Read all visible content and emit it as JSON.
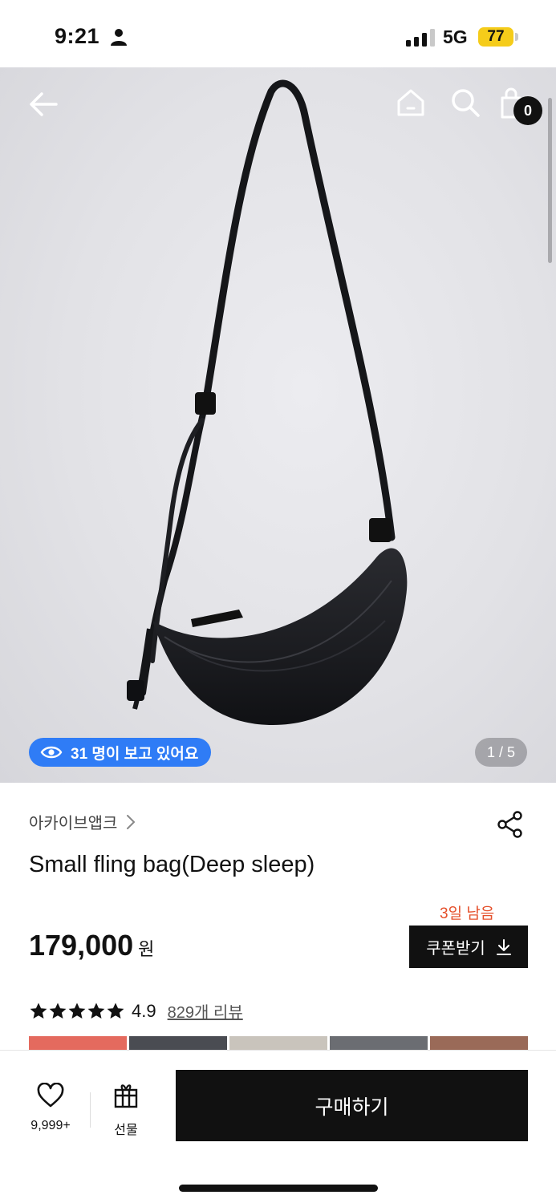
{
  "status_bar": {
    "time": "9:21",
    "network": "5G",
    "battery": "77"
  },
  "gallery": {
    "viewers_text": "31 명이 보고 있어요",
    "pager": "1 / 5",
    "cart_count": "0"
  },
  "product": {
    "brand": "아카이브앱크",
    "title": "Small fling bag(Deep sleep)",
    "coupon_days_left": "3일 남음",
    "price": "179,000",
    "price_unit": "원",
    "coupon_label": "쿠폰받기",
    "rating_value": "4.9",
    "review_count": "829개 리뷰",
    "stars": 5
  },
  "bottom_bar": {
    "like_count": "9,999+",
    "gift_label": "선물",
    "buy_label": "구매하기"
  },
  "colors": {
    "viewers_badge": "#2f7cf6",
    "days_left": "#e5502b",
    "battery": "#f5cc1a"
  },
  "icons": [
    "person-icon",
    "signal-icon",
    "back-arrow-icon",
    "home-icon",
    "search-icon",
    "cart-icon",
    "eye-icon",
    "chevron-right-icon",
    "share-icon",
    "download-icon",
    "star-icon",
    "heart-icon",
    "gift-icon"
  ]
}
